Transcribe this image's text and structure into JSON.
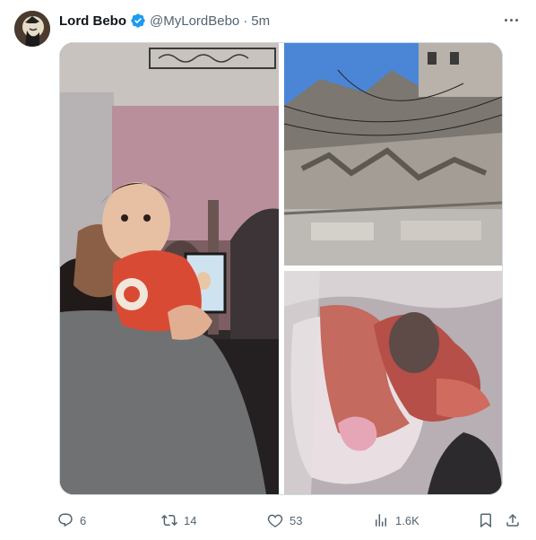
{
  "tweet": {
    "author_name": "Lord Bebo",
    "handle": "@MyLordBebo",
    "separator": "·",
    "time": "5m"
  },
  "media": {
    "images": [
      {
        "subject": "man holding baby in red outfit"
      },
      {
        "subject": "destroyed building rubble"
      },
      {
        "subject": "child wrapped in patterned blanket"
      }
    ]
  },
  "actions": {
    "replies": "6",
    "reposts": "14",
    "likes": "53",
    "views": "1.6K"
  },
  "colors": {
    "text": "#0f1419",
    "secondary": "#536471",
    "verified": "#1d9bf0",
    "border": "#cfd9de"
  }
}
